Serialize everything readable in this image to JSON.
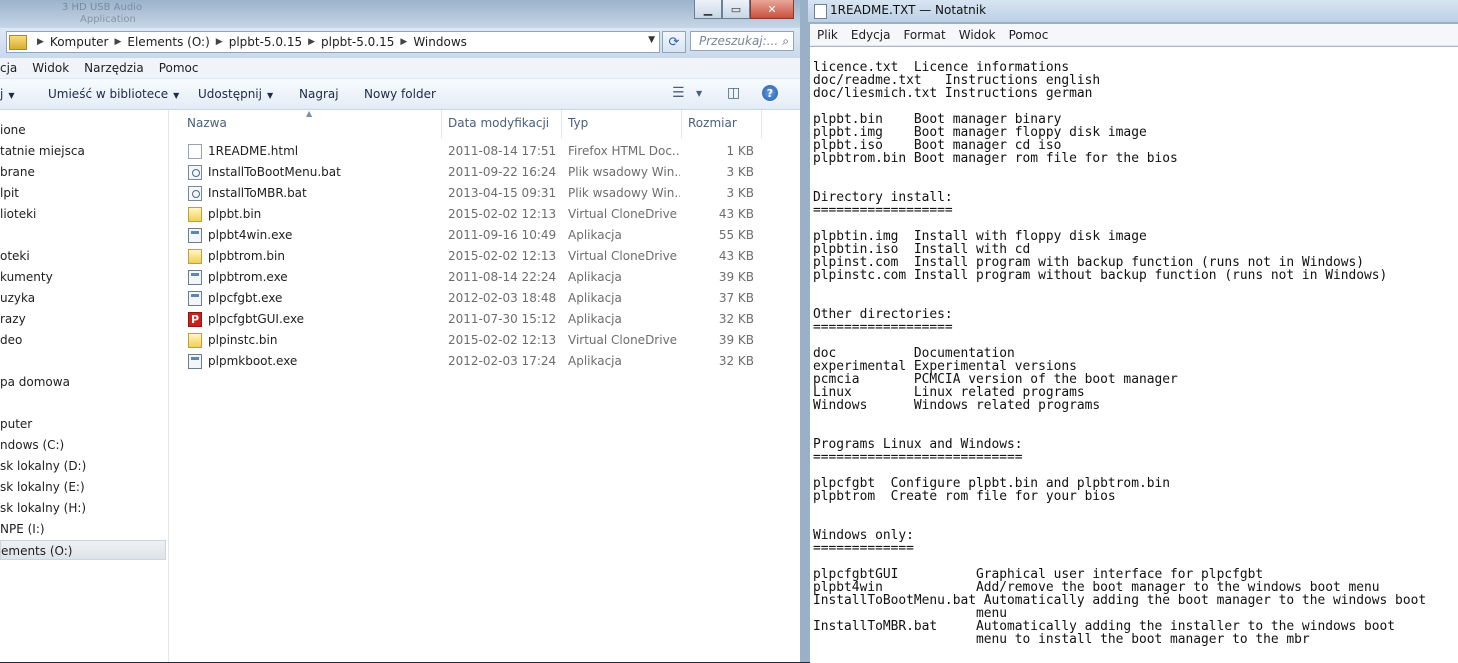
{
  "explorer": {
    "title_ghost": [
      "3 HD USB Audio",
      "Application"
    ],
    "breadcrumbs": [
      "Komputer",
      "Elements (O:)",
      "plpbt-5.0.15",
      "plpbt-5.0.15",
      "Windows"
    ],
    "search_placeholder": "Przeszukaj:...",
    "menu": [
      "cja",
      "Widok",
      "Narzędzia",
      "Pomoc"
    ],
    "toolbar": {
      "organize_fragment": "j",
      "library": "Umieść w bibliotece",
      "share": "Udostępnij",
      "burn": "Nagraj",
      "new_folder": "Nowy folder"
    },
    "nav": [
      {
        "label": "ione"
      },
      {
        "label": "tatnie miejsca"
      },
      {
        "label": "brane"
      },
      {
        "label": "lpit"
      },
      {
        "label": "lioteki"
      },
      {
        "label": "oteki"
      },
      {
        "label": "kumenty"
      },
      {
        "label": "uzyka"
      },
      {
        "label": "razy"
      },
      {
        "label": "deo"
      },
      {
        "label": "pa domowa"
      },
      {
        "label": "puter"
      },
      {
        "label": "ndows (C:)"
      },
      {
        "label": "sk lokalny (D:)"
      },
      {
        "label": "sk lokalny (E:)"
      },
      {
        "label": "sk lokalny (H:)"
      },
      {
        "label": "NPE (I:)"
      },
      {
        "label": "ements (O:)",
        "selected": true
      }
    ],
    "columns": {
      "name": "Nazwa",
      "date": "Data modyfikacji",
      "type": "Typ",
      "size": "Rozmiar"
    },
    "files": [
      {
        "icon": "html-file-icon",
        "name": "1README.html",
        "date": "2011-08-14 17:51",
        "type": "Firefox HTML Doc...",
        "size": "1 KB"
      },
      {
        "icon": "batch-file-icon",
        "name": "InstallToBootMenu.bat",
        "date": "2011-09-22 16:24",
        "type": "Plik wsadowy Win...",
        "size": "3 KB"
      },
      {
        "icon": "batch-file-icon",
        "name": "InstallToMBR.bat",
        "date": "2013-04-15 09:31",
        "type": "Plik wsadowy Win...",
        "size": "3 KB"
      },
      {
        "icon": "bin-file-icon",
        "name": "plpbt.bin",
        "date": "2015-02-02 12:13",
        "type": "Virtual CloneDrive",
        "size": "43 KB"
      },
      {
        "icon": "exe-file-icon",
        "name": "plpbt4win.exe",
        "date": "2011-09-16 10:49",
        "type": "Aplikacja",
        "size": "55 KB"
      },
      {
        "icon": "bin-file-icon",
        "name": "plpbtrom.bin",
        "date": "2015-02-02 12:13",
        "type": "Virtual CloneDrive",
        "size": "43 KB"
      },
      {
        "icon": "exe-file-icon",
        "name": "plpbtrom.exe",
        "date": "2011-08-14 22:24",
        "type": "Aplikacja",
        "size": "39 KB"
      },
      {
        "icon": "exe-file-icon",
        "name": "plpcfgbt.exe",
        "date": "2012-02-03 18:48",
        "type": "Aplikacja",
        "size": "37 KB"
      },
      {
        "icon": "p-app-icon",
        "name": "plpcfgbtGUI.exe",
        "date": "2011-07-30 15:12",
        "type": "Aplikacja",
        "size": "32 KB"
      },
      {
        "icon": "bin-file-icon",
        "name": "plpinstc.bin",
        "date": "2015-02-02 12:13",
        "type": "Virtual CloneDrive",
        "size": "39 KB"
      },
      {
        "icon": "exe-file-icon",
        "name": "plpmkboot.exe",
        "date": "2012-02-03 17:24",
        "type": "Aplikacja",
        "size": "32 KB"
      }
    ]
  },
  "notepad": {
    "title": "1README.TXT — Notatnik",
    "menu": [
      "Plik",
      "Edycja",
      "Format",
      "Widok",
      "Pomoc"
    ],
    "lines": [
      "licence.txt  Licence informations",
      "doc/readme.txt   Instructions english",
      "doc/liesmich.txt Instructions german",
      "",
      "plpbt.bin    Boot manager binary",
      "plpbt.img    Boot manager floppy disk image",
      "plpbt.iso    Boot manager cd iso",
      "plpbtrom.bin Boot manager rom file for the bios",
      "",
      "",
      "Directory install:",
      "==================",
      "",
      "plpbtin.img  Install with floppy disk image",
      "plpbtin.iso  Install with cd",
      "plpinst.com  Install program with backup function (runs not in Windows)",
      "plpinstc.com Install program without backup function (runs not in Windows)",
      "",
      "",
      "Other directories:",
      "==================",
      "",
      "doc          Documentation",
      "experimental Experimental versions",
      "pcmcia       PCMCIA version of the boot manager",
      "Linux        Linux related programs",
      "Windows      Windows related programs",
      "",
      "",
      "Programs Linux and Windows:",
      "===========================",
      "",
      "plpcfgbt  Configure plpbt.bin and plpbtrom.bin",
      "plpbtrom  Create rom file for your bios",
      "",
      "",
      "Windows only:",
      "=============",
      "",
      "plpcfgbtGUI          Graphical user interface for plpcfgbt",
      "plpbt4win            Add/remove the boot manager to the windows boot menu",
      "InstallToBootMenu.bat Automatically adding the boot manager to the windows boot",
      "                     menu",
      "InstallToMBR.bat     Automatically adding the installer to the windows boot",
      "                     menu to install the boot manager to the mbr"
    ]
  }
}
